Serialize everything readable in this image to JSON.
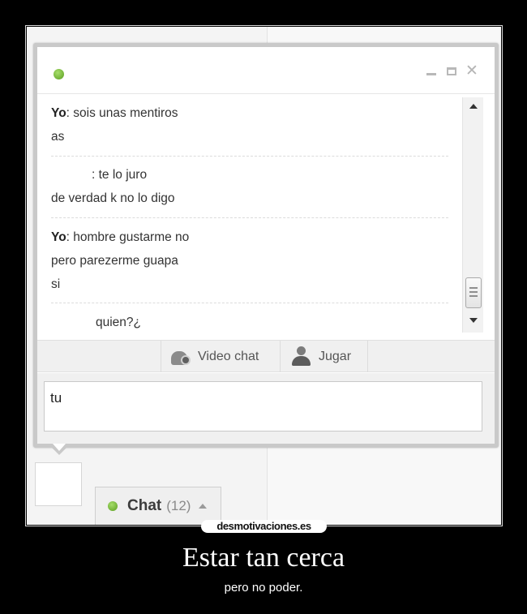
{
  "chat_window": {
    "messages": [
      {
        "sender": "Yo",
        "separator": ":",
        "lines": [
          "sois unas mentiros",
          "as"
        ]
      },
      {
        "sender": "",
        "separator": ":",
        "lines": [
          "te lo juro",
          "de verdad k no lo digo"
        ]
      },
      {
        "sender": "Yo",
        "separator": ":",
        "lines": [
          "hombre gustarme no",
          "pero parezerme guapa",
          "si"
        ]
      },
      {
        "sender": "",
        "separator": "",
        "lines": [
          "quien?¿"
        ]
      }
    ],
    "toolbar": {
      "video_chat_label": "Video chat",
      "play_label": "Jugar"
    },
    "input": {
      "value": "tu"
    }
  },
  "chat_tab": {
    "label": "Chat",
    "count": "(12)"
  },
  "watermark": "desmotivaciones.es",
  "caption": {
    "title": "Estar tan cerca",
    "subtitle": "pero no poder."
  },
  "colors": {
    "online_green": "#6ab82b",
    "background": "#000000"
  }
}
